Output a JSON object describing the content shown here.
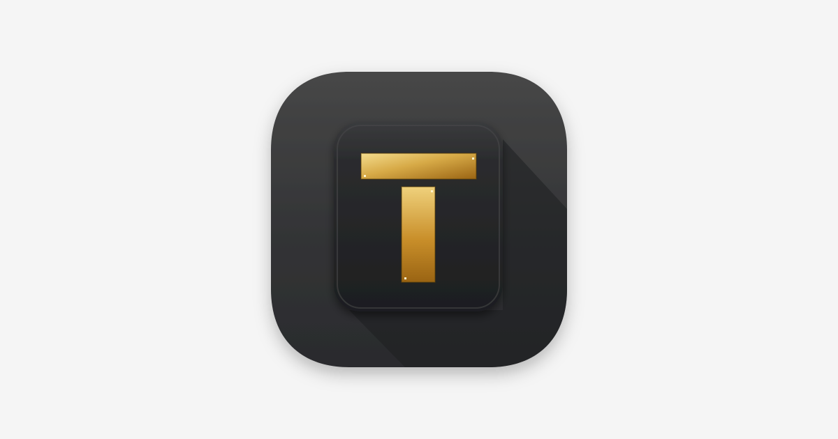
{
  "image": {
    "subject": "app-icon",
    "glyph": "T",
    "icon_name": "letter-t-app-icon"
  },
  "colors": {
    "background": "#f5f5f5",
    "outer_tile_top": "#444444",
    "outer_tile_bottom": "#2a2b2d",
    "inner_key_top": "#333436",
    "inner_key_bottom": "#1f2022",
    "gold_light": "#f3da8c",
    "gold_mid": "#d6a845",
    "gold_dark": "#9a6413"
  }
}
